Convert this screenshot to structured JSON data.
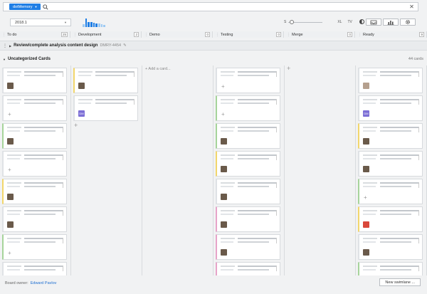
{
  "topbar": {
    "project": "dotMemory",
    "search_placeholder": "",
    "search_value": ""
  },
  "toolbar": {
    "sprint": "2018.1",
    "mini_chart": [
      {
        "h": 0.3,
        "light": true
      },
      {
        "h": 0.9,
        "light": false
      },
      {
        "h": 0.55,
        "light": false
      },
      {
        "h": 0.5,
        "light": false
      },
      {
        "h": 0.45,
        "light": false
      },
      {
        "h": 0.4,
        "light": false
      },
      {
        "h": 0.35,
        "light": true
      },
      {
        "h": 0.3,
        "light": true
      },
      {
        "h": 0.25,
        "light": true
      }
    ],
    "zoom_small": "S",
    "zoom_xl": "XL",
    "zoom_tv": "TV"
  },
  "columns": [
    {
      "name": "To do",
      "count": "25"
    },
    {
      "name": "Development",
      "count": "2"
    },
    {
      "name": "Demo",
      "count": "0"
    },
    {
      "name": "Testing",
      "count": "0"
    },
    {
      "name": "Merge",
      "count": "0"
    },
    {
      "name": "Ready",
      "count": "9"
    }
  ],
  "swimlane": {
    "title": "Review/complete analysis content design",
    "issue_id": "DMRY-4454"
  },
  "uncategorized": {
    "title": "Uncategorized Cards",
    "count": "44 cards"
  },
  "add_card_label": "+ Add a card...",
  "avatar_initials": "DM",
  "footer": {
    "owner_label": "Board owner:",
    "owner_name": "Edward Pavlov",
    "new_swimlane": "New swimlane ..."
  },
  "colors": {
    "accent": "#1f7ee5",
    "stripe_yellow": "#f2d66b",
    "stripe_green": "#a6d49a",
    "stripe_pink": "#e7a4c9",
    "stripe_gray": "#dfe2e5",
    "avatar_initials": "#7d6fd6",
    "avatar_red": "#d9483b",
    "avatar_photo": "#b5a08e"
  }
}
